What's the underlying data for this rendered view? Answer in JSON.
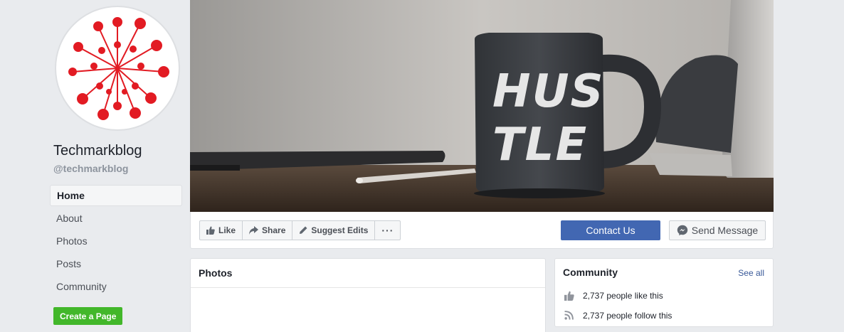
{
  "page": {
    "name": "Techmarkblog",
    "handle": "@techmarkblog"
  },
  "sidebar": {
    "items": [
      {
        "label": "Home",
        "active": true
      },
      {
        "label": "About"
      },
      {
        "label": "Photos"
      },
      {
        "label": "Posts"
      },
      {
        "label": "Community"
      }
    ],
    "create_page_label": "Create a Page"
  },
  "cover": {
    "mug_text_line1": "HUS",
    "mug_text_line2": "TLE"
  },
  "actions": {
    "like_label": "Like",
    "share_label": "Share",
    "suggest_edits_label": "Suggest Edits",
    "more_label": "···",
    "contact_label": "Contact Us",
    "message_label": "Send Message"
  },
  "photos": {
    "title": "Photos"
  },
  "community": {
    "title": "Community",
    "see_all_label": "See all",
    "likes_text": "2,737 people like this",
    "follows_text": "2,737 people follow this"
  },
  "colors": {
    "background": "#e9ebee",
    "primary": "#4267b2",
    "create_button": "#42b72a",
    "link": "#385898",
    "logo_red": "#e21b23"
  },
  "icons": [
    "like-icon",
    "share-icon",
    "pencil-icon",
    "more-icon",
    "messenger-icon",
    "thumbs-up-icon",
    "rss-icon"
  ]
}
